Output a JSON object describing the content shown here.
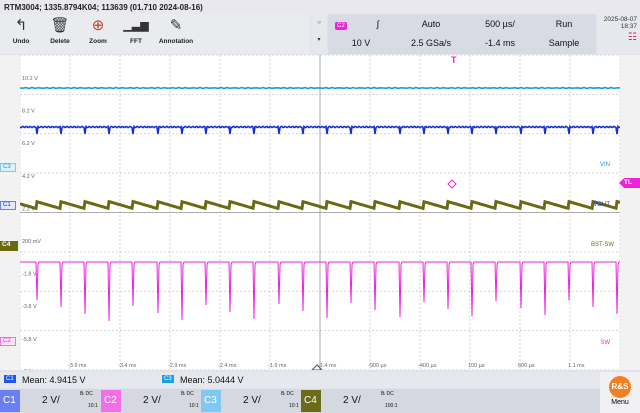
{
  "title": "RTM3004; 1335.8794K04; 113639 (01.710 2024-08-16)",
  "toolbar": [
    {
      "name": "undo",
      "label": "Undo",
      "icon": "undo-icon"
    },
    {
      "name": "delete",
      "label": "Delete",
      "icon": "trash-icon"
    },
    {
      "name": "zoom",
      "label": "Zoom",
      "icon": "zoom-icon"
    },
    {
      "name": "fft",
      "label": "FFT",
      "icon": "fft-icon"
    },
    {
      "name": "annotation",
      "label": "Annotation",
      "icon": "pencil-icon"
    }
  ],
  "settings": {
    "trig_channel": "C2",
    "slope": "∫",
    "trig_mode": "Auto",
    "timebase": "500 µs/",
    "run_state": "Run",
    "trig_level": "10 V",
    "sample_rate": "2.5 GSa/s",
    "trig_position": "-1.4 ms",
    "acq_mode": "Sample"
  },
  "date": "2025-08-07",
  "time": "18:37",
  "markers": {
    "T": "T",
    "TL": "TL",
    "C3": "C3",
    "C1": "C1",
    "C4": "C4",
    "C2": "C2"
  },
  "level_labels": [
    "10.2 V",
    "8.2 V",
    "6.2 V",
    "4.2 V",
    "2.2 V",
    "200 mV",
    "-1.8 V",
    "-3.8 V",
    "-5.8 V",
    "-7.8 V"
  ],
  "time_labels": [
    "-3.9 ms",
    "-3.4 ms",
    "-2.9 ms",
    "-2.4 ms",
    "-1.9 ms",
    "-1.4 ms",
    "-900 µs",
    "-400 µs",
    "100 µs",
    "600 µs",
    "1.1 ms"
  ],
  "trace_labels": {
    "vin": "VIN",
    "vout": "VOUT",
    "bst": "BST-SW",
    "sw": "SW"
  },
  "measurements": [
    {
      "channel": "C1",
      "text": "Mean: 4.9415 V",
      "color": "#2255ee"
    },
    {
      "channel": "C3",
      "text": "Mean: 5.0444 V",
      "color": "#1da0e0"
    }
  ],
  "channels": [
    {
      "id": "C1",
      "scale": "2 V/",
      "coupling": "DC",
      "probe": "10:1",
      "color": "#6a7ff0",
      "bw": "Bₗ DC"
    },
    {
      "id": "C2",
      "scale": "2 V/",
      "coupling": "DC",
      "probe": "10:1",
      "color": "#f26ee8",
      "bw": "Bₗ DC"
    },
    {
      "id": "C3",
      "scale": "2 V/",
      "coupling": "DC",
      "probe": "10:1",
      "color": "#7ec8f2",
      "bw": "Bₗ DC"
    },
    {
      "id": "C4",
      "scale": "2 V/",
      "coupling": "DC",
      "probe": "100:1",
      "color": "#6b6b1a",
      "bw": "Bₗ DC"
    }
  ],
  "menu_label": "Menu",
  "colors": {
    "c1": "#1530d8",
    "c2": "#ee22dd",
    "c3": "#1a9ae0",
    "c4": "#6b6a10",
    "trigger": "#ee22dd"
  }
}
